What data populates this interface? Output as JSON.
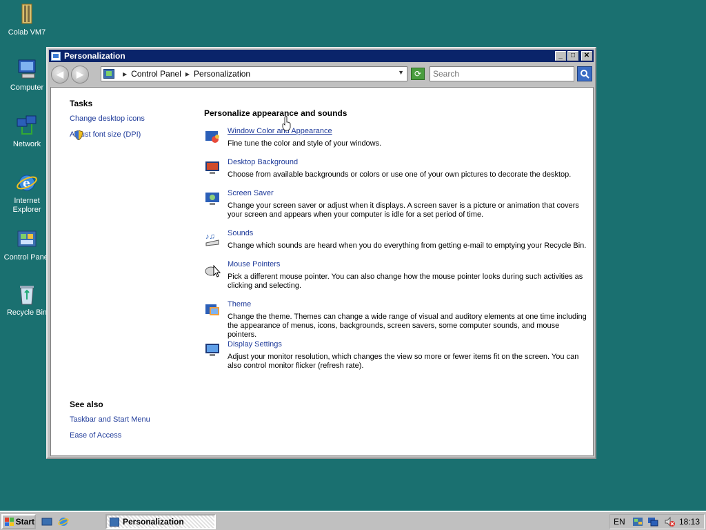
{
  "desktop": {
    "icons": [
      {
        "label": "Colab VM7"
      },
      {
        "label": "Computer"
      },
      {
        "label": "Network"
      },
      {
        "label": "Internet Explorer"
      },
      {
        "label": "Control Panel"
      },
      {
        "label": "Recycle Bin"
      }
    ]
  },
  "window": {
    "title": "Personalization",
    "breadcrumb": [
      "Control Panel",
      "Personalization"
    ],
    "search_placeholder": "Search"
  },
  "sidebar": {
    "tasks_heading": "Tasks",
    "tasks": [
      {
        "label": "Change desktop icons"
      },
      {
        "label": "Adjust font size (DPI)"
      }
    ],
    "see_also_heading": "See also",
    "see_also": [
      {
        "label": "Taskbar and Start Menu"
      },
      {
        "label": "Ease of Access"
      }
    ]
  },
  "main": {
    "heading": "Personalize appearance and sounds",
    "items": [
      {
        "title": "Window Color and Appearance",
        "desc": "Fine tune the color and style of your windows.",
        "icon": "window-color-icon"
      },
      {
        "title": "Desktop Background",
        "desc": "Choose from available backgrounds or colors or use one of your own pictures to decorate the desktop.",
        "icon": "desktop-background-icon"
      },
      {
        "title": "Screen Saver",
        "desc": "Change your screen saver or adjust when it displays. A screen saver is a picture or animation that covers your screen and appears when your computer is idle for a set period of time.",
        "icon": "screen-saver-icon"
      },
      {
        "title": "Sounds",
        "desc": "Change which sounds are heard when you do everything from getting e-mail to emptying your Recycle Bin.",
        "icon": "sounds-icon"
      },
      {
        "title": "Mouse Pointers",
        "desc": "Pick a different mouse pointer. You can also change how the mouse pointer looks during such activities as clicking and selecting.",
        "icon": "mouse-pointers-icon"
      },
      {
        "title": "Theme",
        "desc": "Change the theme. Themes can change a wide range of visual and auditory elements at one time including the appearance of menus, icons, backgrounds, screen savers, some computer sounds, and mouse pointers.",
        "icon": "theme-icon"
      },
      {
        "title": "Display Settings",
        "desc": "Adjust your monitor resolution, which changes the view so more or fewer items fit on the screen. You can also control monitor flicker (refresh rate).",
        "icon": "display-settings-icon"
      }
    ]
  },
  "taskbar": {
    "start_label": "Start",
    "task_label": "Personalization",
    "language": "EN",
    "clock": "18:13"
  },
  "colors": {
    "desktop": "#1a7070",
    "titlebar": "#0a246a",
    "link": "#1f3b9a"
  }
}
